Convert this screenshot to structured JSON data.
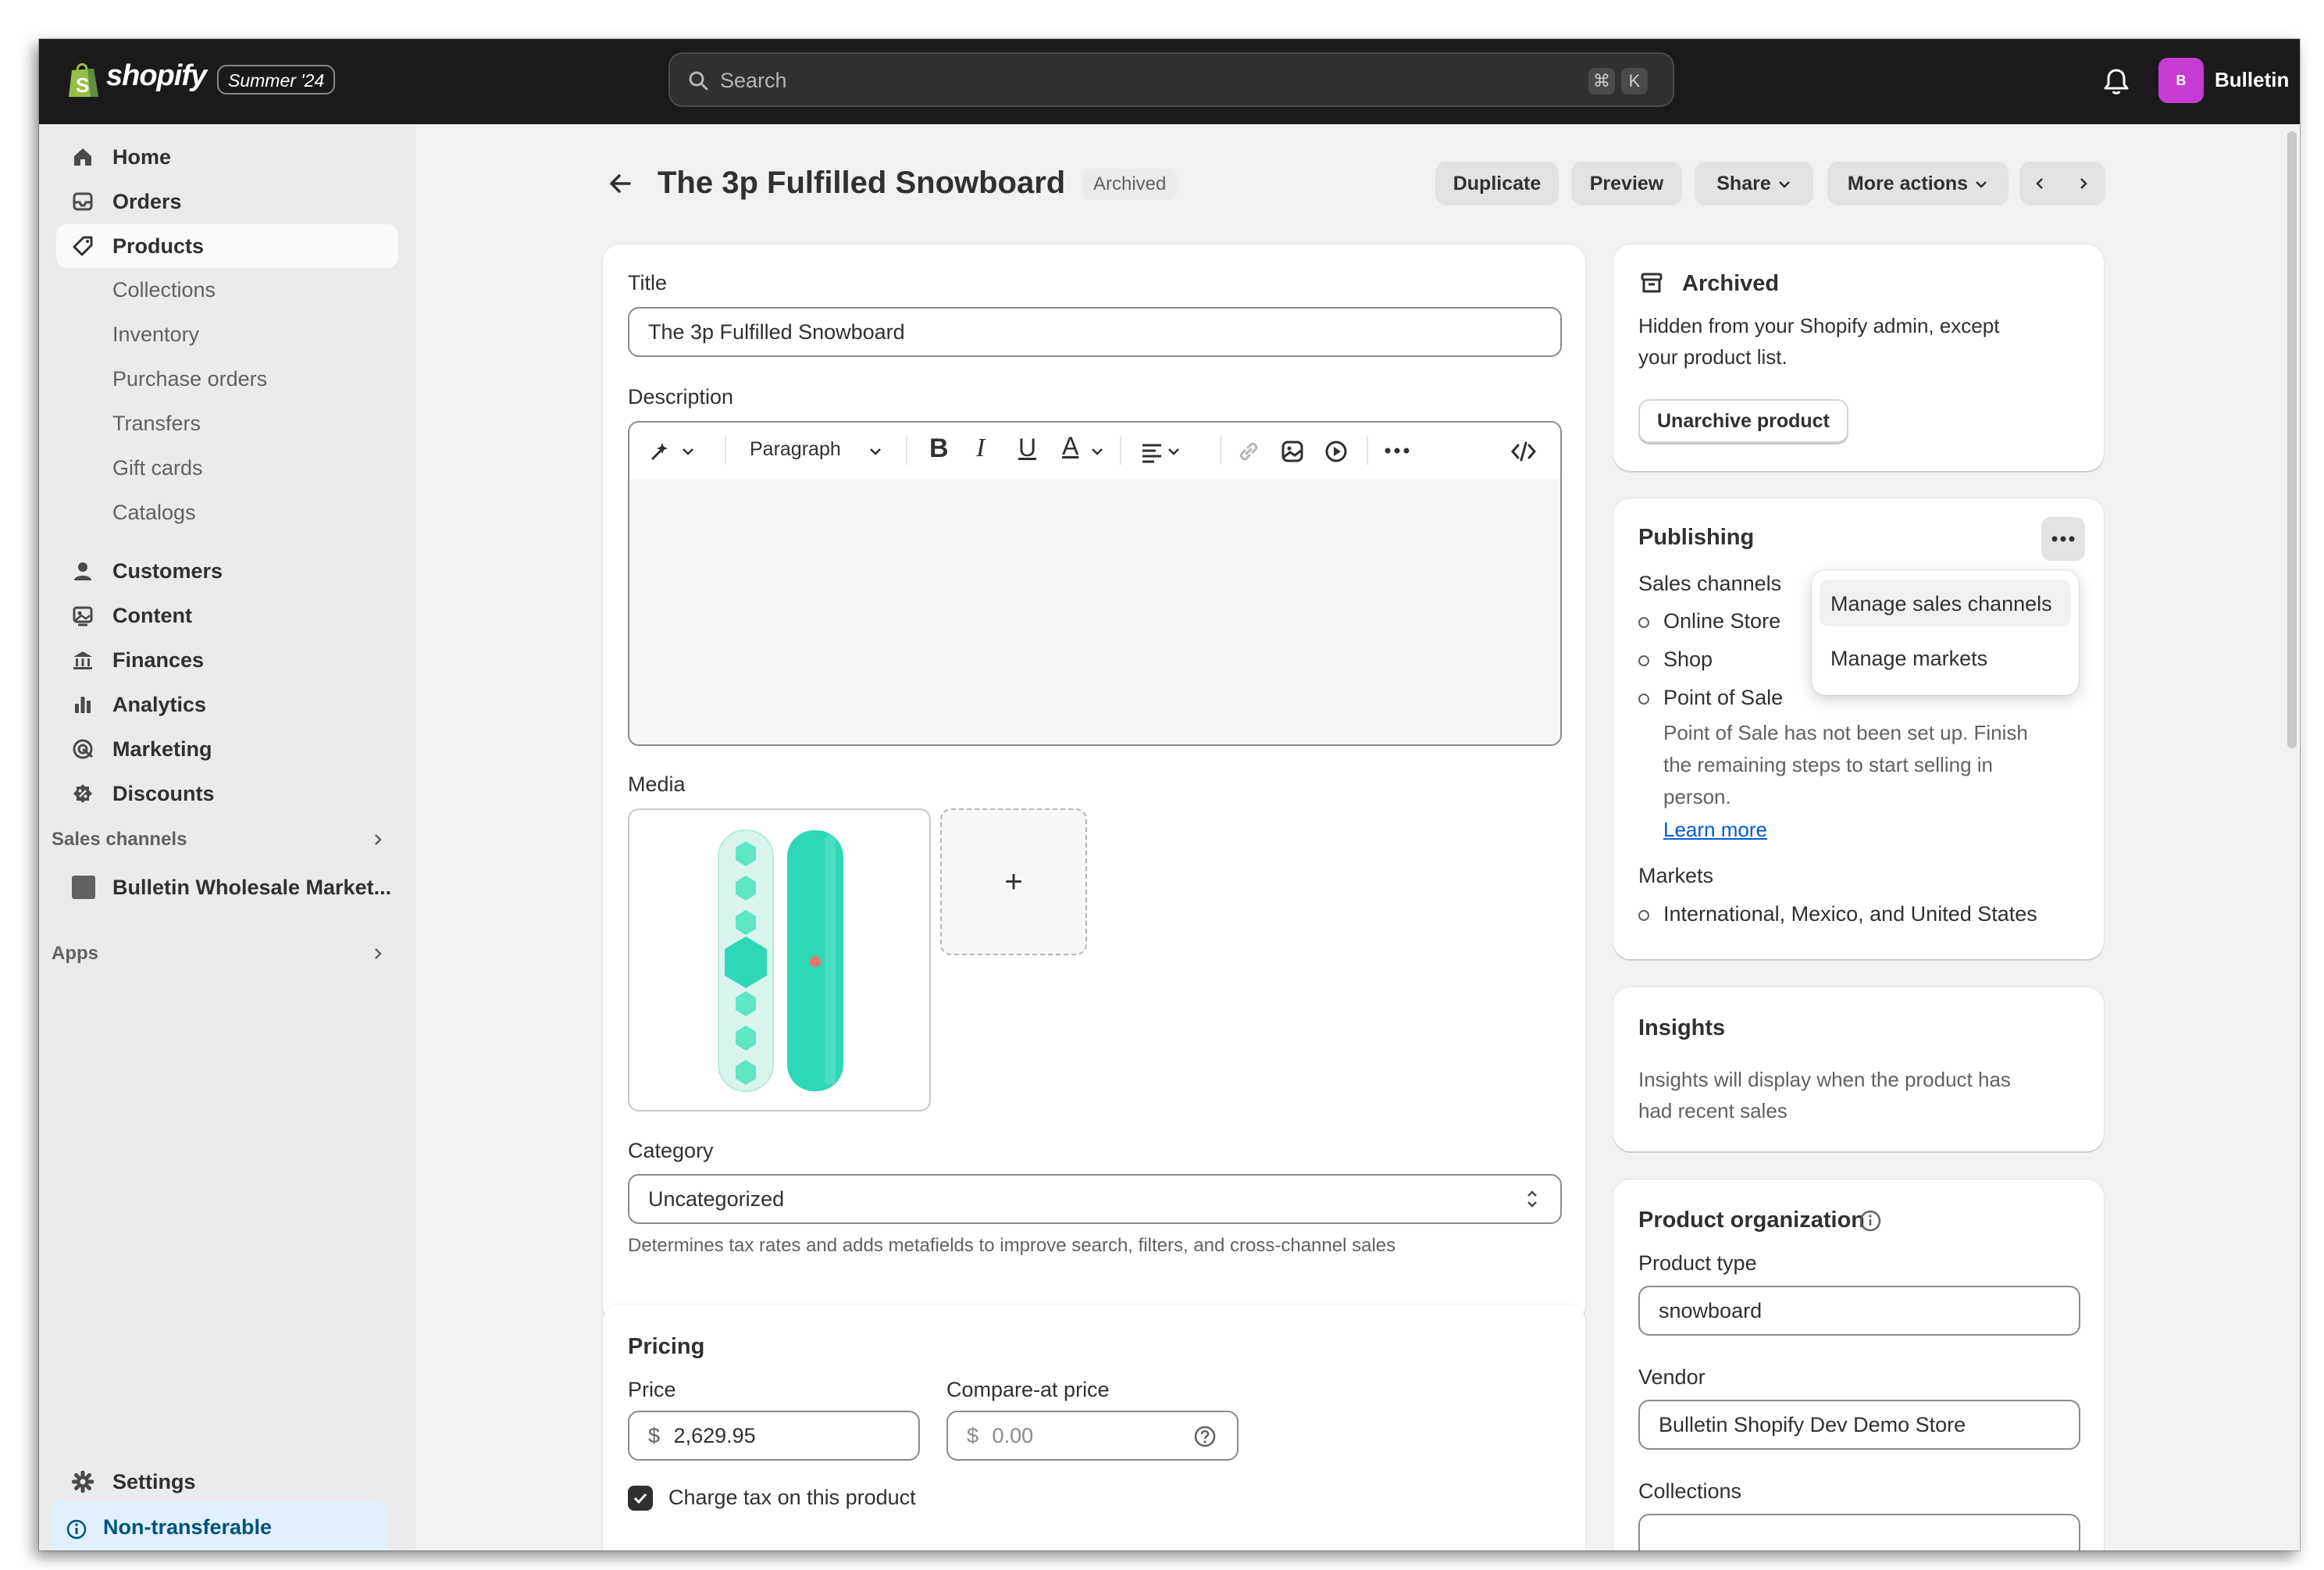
{
  "topbar": {
    "logo_text": "shopify",
    "edition": "Summer '24",
    "search_placeholder": "Search",
    "shortcut_keys": [
      "⌘",
      "K"
    ],
    "store_avatar": "B",
    "store_name": "Bulletin"
  },
  "sidebar": {
    "primary": [
      {
        "label": "Home",
        "icon": "home-icon"
      },
      {
        "label": "Orders",
        "icon": "inbox-icon"
      },
      {
        "label": "Products",
        "icon": "tag-icon",
        "active": true
      }
    ],
    "product_sub": [
      "Collections",
      "Inventory",
      "Purchase orders",
      "Transfers",
      "Gift cards",
      "Catalogs"
    ],
    "secondary": [
      {
        "label": "Customers",
        "icon": "person-icon"
      },
      {
        "label": "Content",
        "icon": "content-icon"
      },
      {
        "label": "Finances",
        "icon": "bank-icon"
      },
      {
        "label": "Analytics",
        "icon": "bar-chart-icon"
      },
      {
        "label": "Marketing",
        "icon": "target-icon"
      },
      {
        "label": "Discounts",
        "icon": "discount-icon"
      }
    ],
    "sales_channels_title": "Sales channels",
    "sales_channel_item": "Bulletin Wholesale Market...",
    "apps_title": "Apps",
    "settings_label": "Settings",
    "non_transferable": "Non-transferable"
  },
  "header": {
    "title": "The 3p Fulfilled Snowboard",
    "status": "Archived",
    "actions": {
      "duplicate": "Duplicate",
      "preview": "Preview",
      "share": "Share",
      "more": "More actions"
    }
  },
  "product": {
    "title_label": "Title",
    "title_value": "The 3p Fulfilled Snowboard",
    "description_label": "Description",
    "paragraph_style": "Paragraph",
    "media_label": "Media",
    "add_media": "+",
    "category_label": "Category",
    "category_value": "Uncategorized",
    "category_help": "Determines tax rates and adds metafields to improve search, filters, and cross-channel sales"
  },
  "pricing": {
    "title": "Pricing",
    "price_label": "Price",
    "currency": "$",
    "price_value": "2,629.95",
    "compare_label": "Compare-at price",
    "compare_placeholder": "0.00",
    "charge_tax_label": "Charge tax on this product",
    "charge_tax_checked": true
  },
  "archived_card": {
    "title": "Archived",
    "line1": "Hidden from your Shopify admin, except",
    "line2": "your product list.",
    "button": "Unarchive product"
  },
  "publishing": {
    "title": "Publishing",
    "sales_channels_label": "Sales channels",
    "channels": [
      "Online Store",
      "Shop",
      "Point of Sale"
    ],
    "pos_note_lines": [
      "Point of Sale has not been set up. Finish",
      "the remaining steps to start selling in",
      "person."
    ],
    "learn_more": "Learn more",
    "markets_label": "Markets",
    "markets_value": "International, Mexico, and United States",
    "menu": [
      "Manage sales channels",
      "Manage markets"
    ]
  },
  "insights": {
    "title": "Insights",
    "line1": "Insights will display when the product has",
    "line2": "had recent sales"
  },
  "organization": {
    "title": "Product organization",
    "type_label": "Product type",
    "type_value": "snowboard",
    "vendor_label": "Vendor",
    "vendor_value": "Bulletin Shopify Dev Demo Store",
    "collections_label": "Collections"
  },
  "colors": {
    "topbar": "#1a1a1a",
    "background": "#f1f1f1",
    "avatar": "#c63bd3",
    "link": "#005bd3",
    "snowboard": "#2fd8b4"
  }
}
